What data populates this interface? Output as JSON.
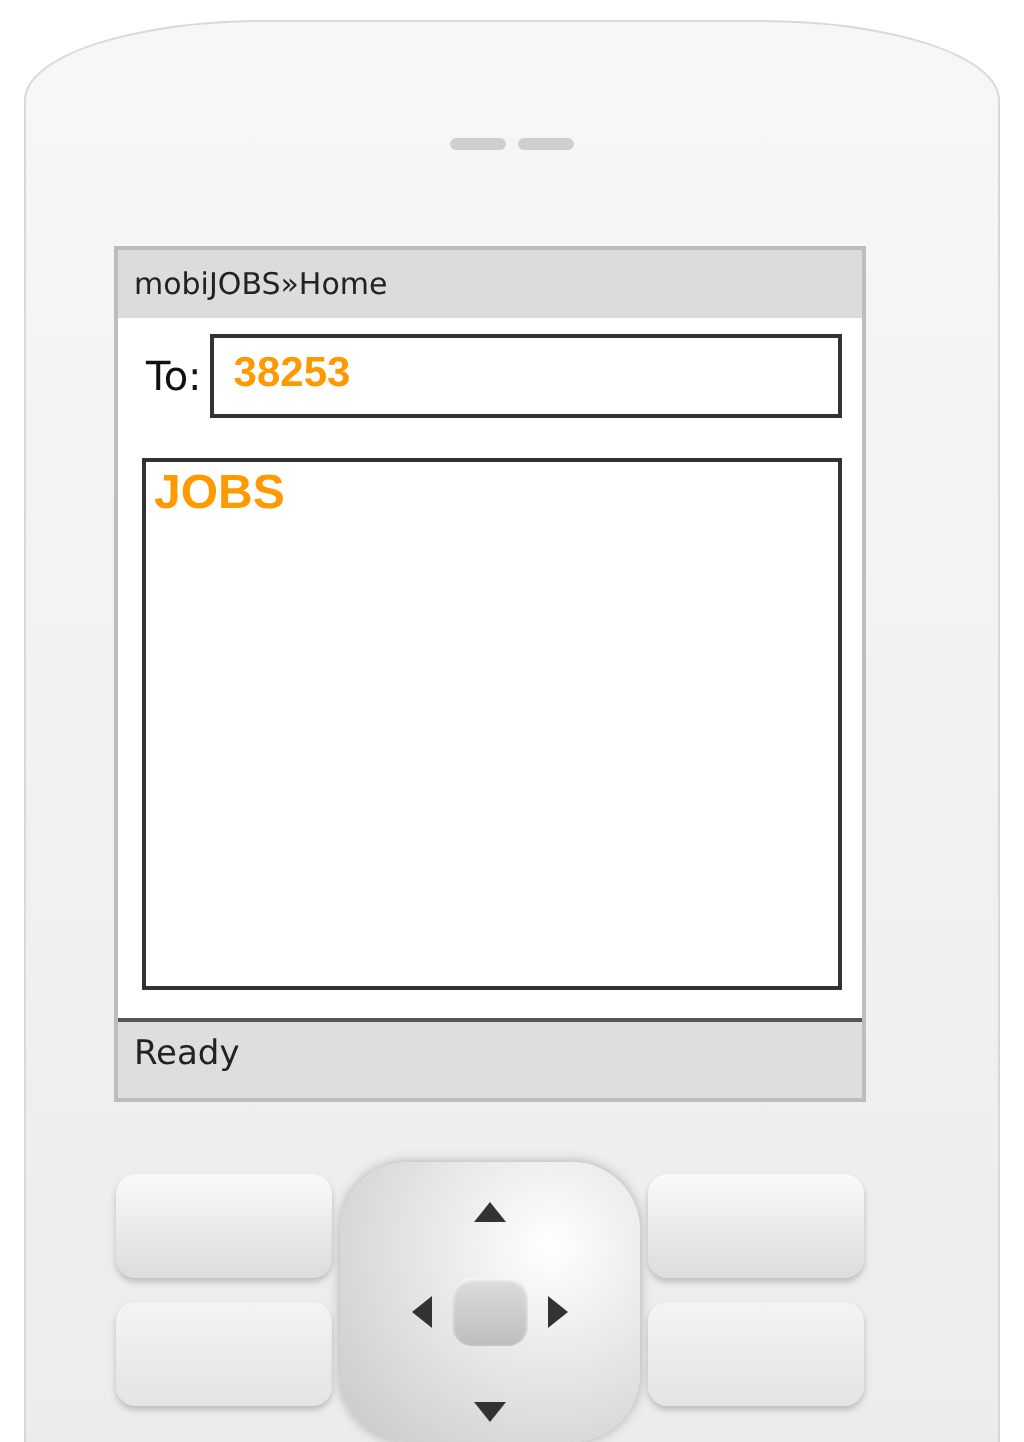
{
  "screen": {
    "title": "mobiJOBS»Home",
    "to_label": "To:",
    "to_value": "38253",
    "content_heading": "JOBS",
    "status_bar": "Ready"
  }
}
